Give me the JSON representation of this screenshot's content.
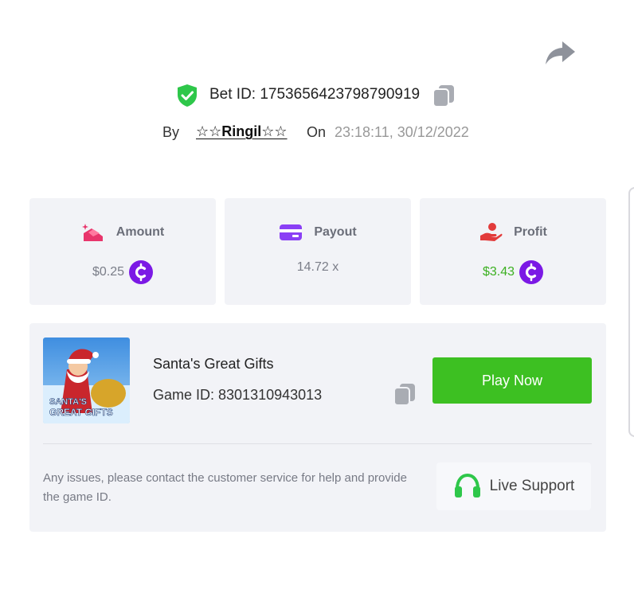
{
  "header": {
    "share_icon": "share-arrow-icon",
    "bet_id_text": "Bet ID: 1753656423798790919",
    "by_label": "By",
    "username": "☆☆Ringil☆☆",
    "on_label": "On",
    "timestamp": "23:18:11, 30/12/2022"
  },
  "stats": [
    {
      "icon": "amount-icon",
      "label": "Amount",
      "value": "$0.25",
      "currency_icon": "coin-c-icon"
    },
    {
      "icon": "payout-card-icon",
      "label": "Payout",
      "value": "14.72 x"
    },
    {
      "icon": "profit-hand-icon",
      "label": "Profit",
      "value": "$3.43",
      "currency_icon": "coin-c-icon"
    }
  ],
  "game": {
    "name": "Santa's Great Gifts",
    "id_text": "Game ID: 8301310943013",
    "thumbnail_text_line1": "SANTA'S",
    "thumbnail_text_line2": "GREAT GIFTS",
    "play_label": "Play Now"
  },
  "support": {
    "message": "Any issues, please contact the customer service for help and provide the game ID.",
    "button_label": "Live Support"
  },
  "colors": {
    "accent_green": "#3dc022",
    "profit_green": "#3cb021",
    "coin_purple": "#7b19e5",
    "card_bg": "#f2f3f7"
  }
}
